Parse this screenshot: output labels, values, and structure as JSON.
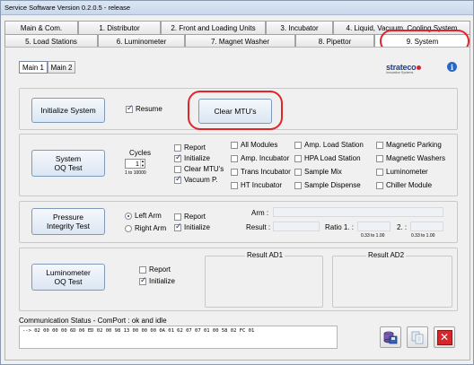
{
  "window": {
    "title": "Service Software Version 0.2.0.5 - release"
  },
  "tabs_row1": [
    {
      "label": "Main & Com."
    },
    {
      "label": "1. Distributor"
    },
    {
      "label": "2. Front and Loading Units"
    },
    {
      "label": "3. Incubator"
    },
    {
      "label": "4. Liquid, Vacuum, Cooling System"
    }
  ],
  "tabs_row2": [
    {
      "label": "5. Load Stations"
    },
    {
      "label": "6. Luminometer"
    },
    {
      "label": "7. Magnet Washer"
    },
    {
      "label": "8. Pipettor"
    },
    {
      "label": "9. System"
    }
  ],
  "subtabs": [
    {
      "label": "Main 1"
    },
    {
      "label": "Main 2"
    }
  ],
  "brand": {
    "logo_text": "strateco",
    "logo_sub": "Innovative Systems",
    "accent": "#1c3e8a"
  },
  "init": {
    "button": "Initialize System",
    "resume": "Resume",
    "clear": "Clear MTU's"
  },
  "oq": {
    "button_line1": "System",
    "button_line2": "OQ Test",
    "cycles_label": "Cycles",
    "cycles_value": "1",
    "cycles_range": "1 to 10000",
    "col1": [
      {
        "label": "Report",
        "checked": false
      },
      {
        "label": "Initialize",
        "checked": true
      },
      {
        "label": "Clear MTU's",
        "checked": false
      },
      {
        "label": "Vacuum P.",
        "checked": true
      }
    ],
    "col2": [
      "All Modules",
      "Amp. Incubator",
      "Trans Incubator",
      "HT Incubator"
    ],
    "col3": [
      "Amp. Load Station",
      "HPA Load Station",
      "Sample Mix",
      "Sample Dispense"
    ],
    "col4": [
      "Magnetic Parking",
      "Magnetic Washers",
      "Luminometer",
      "Chiller Module"
    ]
  },
  "pressure": {
    "button_line1": "Pressure",
    "button_line2": "Integrity Test",
    "left_arm": "Left Arm",
    "right_arm": "Right Arm",
    "report": "Report",
    "initialize": "Initialize",
    "arm_label": "Arm :",
    "result_label": "Result :",
    "ratio1_label": "Ratio 1. :",
    "ratio2_label": "2. :",
    "range1": "0.33 to 1.00",
    "range2": "0.33 to 1.00"
  },
  "lumi": {
    "button_line1": "Luminometer",
    "button_line2": "OQ  Test",
    "report": "Report",
    "initialize": "Initialize",
    "result_ad1": "Result AD1",
    "result_ad2": "Result AD2"
  },
  "comm": {
    "status": "Communication Status - ComPort : ok and idle",
    "data": "--> 02 00 00 00 6D 06 ED 02 00 98 13 00 00 00 0A 01 62 07 07 01 00 58 02 FC 01"
  },
  "icons": {
    "save": "database-save-icon",
    "copy": "copy-icon",
    "close": "close-icon",
    "close_color": "#d6262b"
  }
}
